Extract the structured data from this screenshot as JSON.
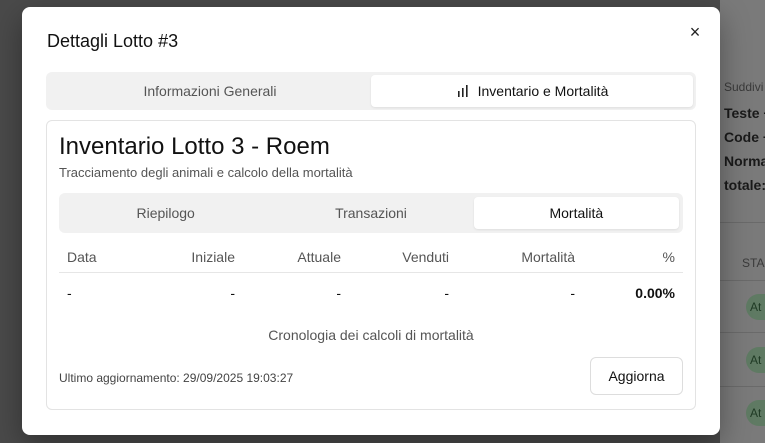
{
  "background": {
    "side_texts": [
      "Suddivi",
      "Teste +",
      "Code +",
      "Norma",
      "totale:"
    ],
    "column_header": "STA",
    "status_pill": "At"
  },
  "modal": {
    "title": "Dettagli Lotto #3",
    "close_symbol": "×",
    "tabs": [
      {
        "label": "Informazioni Generali",
        "active": false
      },
      {
        "label": "Inventario e Mortalità",
        "active": true,
        "icon": "bar-chart-icon"
      }
    ]
  },
  "card": {
    "title": "Inventario Lotto 3 - Roem",
    "subtitle": "Tracciamento degli animali e calcolo della mortalità",
    "tabs": [
      {
        "label": "Riepilogo",
        "active": false
      },
      {
        "label": "Transazioni",
        "active": false
      },
      {
        "label": "Mortalità",
        "active": true
      }
    ],
    "table": {
      "headers": [
        "Data",
        "Iniziale",
        "Attuale",
        "Venduti",
        "Mortalità",
        "%"
      ],
      "rows": [
        [
          "-",
          "-",
          "-",
          "-",
          "-",
          "0.00%"
        ]
      ]
    },
    "caption": "Cronologia dei calcoli di mortalità",
    "last_update": "Ultimo aggiornamento: 29/09/2025 19:03:27",
    "refresh_label": "Aggiorna"
  }
}
